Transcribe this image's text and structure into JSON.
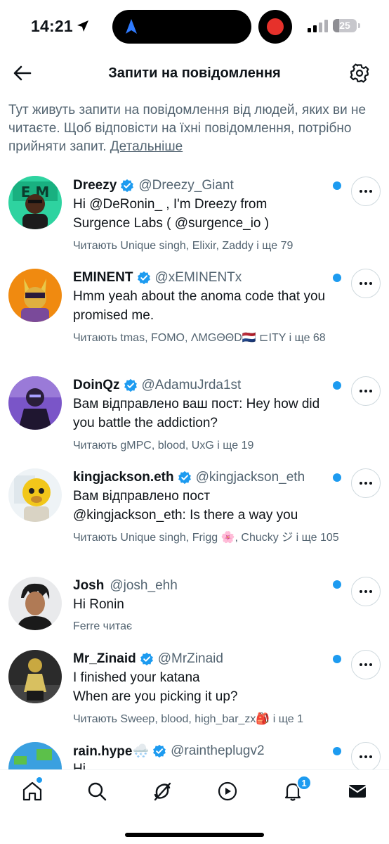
{
  "status_bar": {
    "time": "14:21",
    "battery": "25",
    "battery_level": 0.25
  },
  "header": {
    "title": "Запити на повідомлення"
  },
  "intro": {
    "text": "Тут живуть запити на повідомлення від людей, яких ви не читаєте. Щоб відповісти на їхні повідомлення, потрібно прийняти запит. ",
    "link": "Детальніше"
  },
  "requests": [
    {
      "name": "Dreezy",
      "verified": true,
      "handle": "@Dreezy_Giant",
      "message": "Hi @DeRonin_ , I'm Dreezy from Surgence Labs  ( @surgence_io )",
      "followers": "Читають Unique singh, Elixir, Zaddy і ще 79",
      "unread": true
    },
    {
      "name": "EMINENT",
      "verified": true,
      "handle": "@xEMINENTx",
      "message": "Hmm yeah about the anoma code that you promised me.",
      "followers": "Читають tmas, FOMO, ΛMGΘΘD🇳🇱 ⊏ITY і ще 68",
      "unread": true
    },
    {
      "name": "DoinQz",
      "verified": true,
      "handle": "@AdamuJrda1st",
      "message": "Вам відправлено ваш пост: Hey how did you battle the addiction?",
      "followers": "Читають gMPC, blood, UxG і ще 19",
      "unread": true
    },
    {
      "name": "kingjackson.eth",
      "verified": true,
      "handle": "@kingjackson_eth",
      "message": "Вам відправлено пост @kingjackson_eth: Is there a way you",
      "followers": "Читають Unique singh, Frigg 🌸, Chucky ジ і ще 105",
      "unread": true
    },
    {
      "name": "Josh",
      "verified": false,
      "handle": "@josh_ehh",
      "message": "Hi Ronin",
      "followers": "Ferre читає",
      "unread": true
    },
    {
      "name": "Mr_Zinaid",
      "verified": true,
      "handle": "@MrZinaid",
      "message": "I finished your katana\nWhen are you picking it up?",
      "followers": "Читають Sweep, blood, high_bar_zx🎒 і ще 1",
      "unread": true
    },
    {
      "name": "rain.hype🌨️",
      "verified": true,
      "handle": "@raintheplugv2",
      "message": "Hi",
      "followers": "",
      "unread": true
    }
  ],
  "tabbar": {
    "items": [
      "home-icon",
      "search-icon",
      "grok-icon",
      "video-icon",
      "bell-icon",
      "mail-icon"
    ],
    "notifications_count": "1"
  },
  "colors": {
    "accent": "#1d9bf0",
    "text": "#0f1419",
    "secondary": "#536471"
  }
}
